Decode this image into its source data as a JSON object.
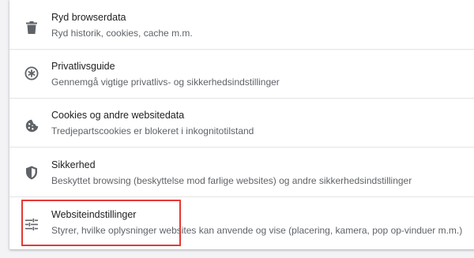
{
  "highlight_color": "#e53935",
  "items": [
    {
      "icon": "trash-icon",
      "title": "Ryd browserdata",
      "subtitle": "Ryd historik, cookies, cache m.m."
    },
    {
      "icon": "privacy-guide-icon",
      "title": "Privatlivsguide",
      "subtitle": "Gennemgå vigtige privatlivs- og sikkerhedsindstillinger"
    },
    {
      "icon": "cookie-icon",
      "title": "Cookies og andre websitedata",
      "subtitle": "Tredjepartscookies er blokeret i inkognitotilstand"
    },
    {
      "icon": "shield-icon",
      "title": "Sikkerhed",
      "subtitle": "Beskyttet browsing (beskyttelse mod farlige websites) og andre sikkerhedsindstillinger"
    },
    {
      "icon": "tune-sliders-icon",
      "title": "Websiteindstillinger",
      "subtitle": "Styrer, hvilke oplysninger websites kan anvende og vise (placering, kamera, pop op-vinduer m.m.)"
    }
  ]
}
